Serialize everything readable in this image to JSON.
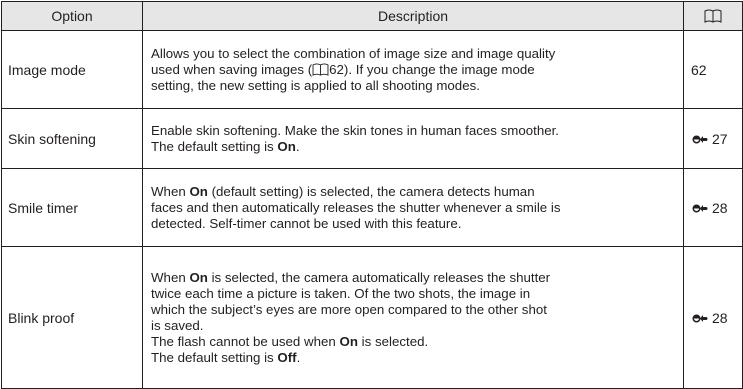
{
  "header": {
    "option": "Option",
    "description": "Description",
    "ref_icon": "book-reference-icon"
  },
  "rows": [
    {
      "option": "Image mode",
      "lines": [
        [
          "Allows you to select the combination of image size and image quality"
        ],
        [
          "used when saving images (",
          "62). If you change the image mode"
        ],
        [
          "setting, the new setting is applied to all shooting modes."
        ]
      ],
      "page": "62"
    },
    {
      "option": "Skin softening",
      "lines": [
        [
          "Enable skin softening. Make the skin tones in human faces smoother."
        ],
        [
          "The default setting is ",
          "On",
          "."
        ]
      ],
      "page_icon": "reference-section-icon",
      "page": "27"
    },
    {
      "option": "Smile timer",
      "lines": [
        [
          "When ",
          "On",
          " (default setting) is selected, the camera detects human"
        ],
        [
          "faces and then automatically releases the shutter whenever a smile is"
        ],
        [
          "detected. Self-timer cannot be used with this feature."
        ]
      ],
      "page_icon": "reference-section-icon",
      "page": "28"
    },
    {
      "option": "Blink proof",
      "lines": [
        [
          "When ",
          "On",
          " is selected, the camera automatically releases the shutter"
        ],
        [
          "twice each time a picture is taken. Of the two shots, the image in"
        ],
        [
          "which the subject’s eyes are more open compared to the other shot"
        ],
        [
          "is saved."
        ],
        [
          "The flash cannot be used when ",
          "On",
          " is selected."
        ],
        [
          "The default setting is ",
          "Off",
          "."
        ]
      ],
      "page_icon": "reference-section-icon",
      "page": "28"
    }
  ]
}
